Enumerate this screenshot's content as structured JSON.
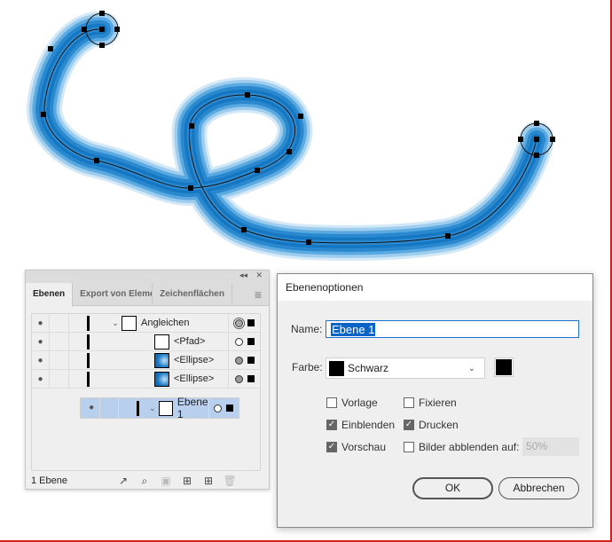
{
  "artwork": {
    "gradient_light": "#d3e9f8",
    "gradient_dark": "#0a5fa8"
  },
  "layers_panel": {
    "collapse_icon": "double-chevron-left-icon",
    "close_icon": "close-icon",
    "tabs": [
      "Ebenen",
      "Export von Elementen",
      "Zeichenflächen"
    ],
    "rows": [
      {
        "name": "Ebene 1",
        "indent": 0,
        "expanded": true,
        "selected": true,
        "target": "empty"
      },
      {
        "name": "Angleichen",
        "indent": 1,
        "expanded": true,
        "selected": false,
        "target": "double"
      },
      {
        "name": "<Pfad>",
        "indent": 2,
        "selected": false,
        "target": "empty"
      },
      {
        "name": "<Ellipse>",
        "indent": 2,
        "selected": false,
        "target": "filled"
      },
      {
        "name": "<Ellipse>",
        "indent": 2,
        "selected": false,
        "target": "filled"
      }
    ],
    "status": "1 Ebene"
  },
  "dialog": {
    "title": "Ebenenoptionen",
    "name_label": "Name:",
    "name_value": "Ebene 1",
    "color_label": "Farbe:",
    "color_value": "Schwarz",
    "color_hex": "#000000",
    "checkboxes": {
      "vorlage": {
        "label": "Vorlage",
        "checked": false
      },
      "fixieren": {
        "label": "Fixieren",
        "checked": false
      },
      "einblenden": {
        "label": "Einblenden",
        "checked": true
      },
      "drucken": {
        "label": "Drucken",
        "checked": true
      },
      "vorschau": {
        "label": "Vorschau",
        "checked": true
      },
      "abblenden": {
        "label": "Bilder abblenden auf:",
        "checked": false
      }
    },
    "dim_value": "50%",
    "ok": "OK",
    "cancel": "Abbrechen"
  }
}
